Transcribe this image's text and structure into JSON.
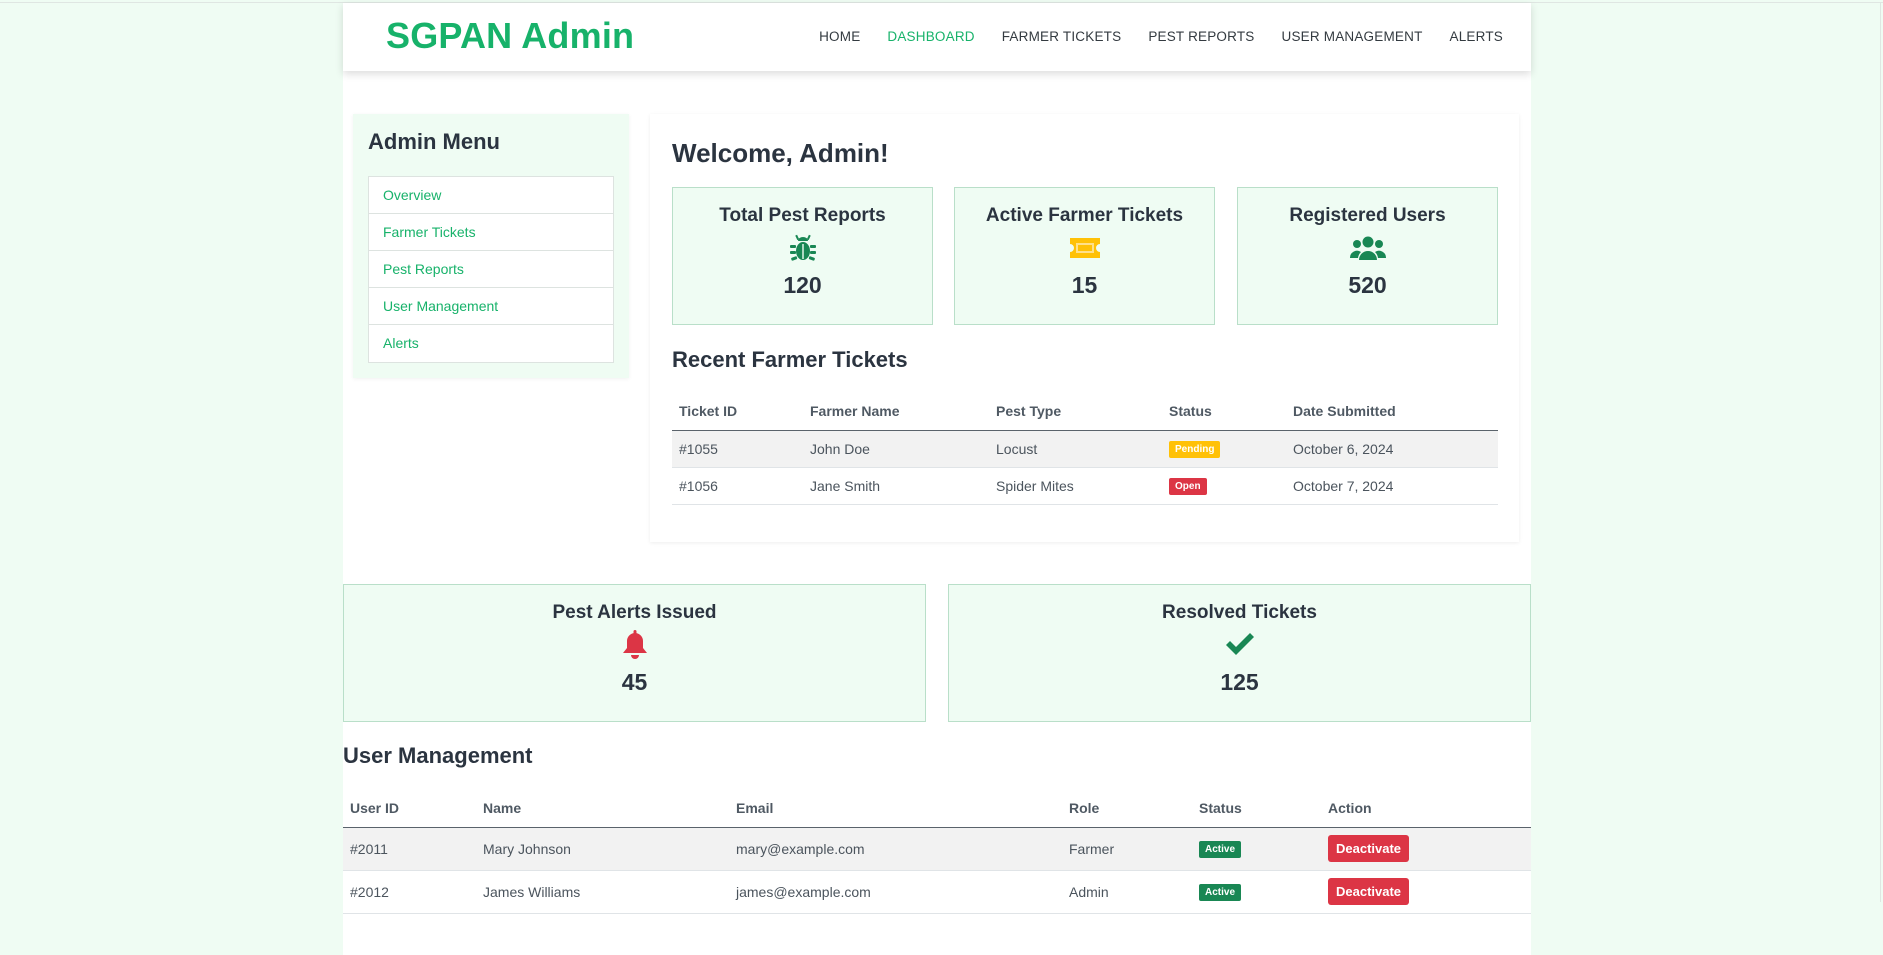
{
  "header": {
    "brand": "SGPAN Admin",
    "nav": [
      "HOME",
      "DASHBOARD",
      "FARMER TICKETS",
      "PEST REPORTS",
      "USER MANAGEMENT",
      "ALERTS"
    ],
    "active_nav": "DASHBOARD"
  },
  "sidebar": {
    "title": "Admin Menu",
    "items": [
      {
        "label": "Overview"
      },
      {
        "label": "Farmer Tickets"
      },
      {
        "label": "Pest Reports"
      },
      {
        "label": "User Management"
      },
      {
        "label": "Alerts"
      }
    ]
  },
  "main": {
    "welcome": "Welcome, Admin!",
    "stats": [
      {
        "title": "Total Pest Reports",
        "value": "120",
        "icon": "bug-icon",
        "color": "#198754"
      },
      {
        "title": "Active Farmer Tickets",
        "value": "15",
        "icon": "ticket-icon",
        "color": "#ffc107"
      },
      {
        "title": "Registered Users",
        "value": "520",
        "icon": "users-icon",
        "color": "#198754"
      }
    ],
    "recent_tickets": {
      "title": "Recent Farmer Tickets",
      "headers": [
        "Ticket ID",
        "Farmer Name",
        "Pest Type",
        "Status",
        "Date Submitted"
      ],
      "rows": [
        {
          "id": "#1055",
          "farmer": "John Doe",
          "pest": "Locust",
          "status": "Pending",
          "status_color": "#ffc107",
          "date": "October 6, 2024"
        },
        {
          "id": "#1056",
          "farmer": "Jane Smith",
          "pest": "Spider Mites",
          "status": "Open",
          "status_color": "#dc3545",
          "date": "October 7, 2024"
        }
      ]
    }
  },
  "lower_stats": [
    {
      "title": "Pest Alerts Issued",
      "value": "45",
      "icon": "bell-icon",
      "color": "#dc3545"
    },
    {
      "title": "Resolved Tickets",
      "value": "125",
      "icon": "check-icon",
      "color": "#198754"
    }
  ],
  "user_management": {
    "title": "User Management",
    "headers": [
      "User ID",
      "Name",
      "Email",
      "Role",
      "Status",
      "Action"
    ],
    "rows": [
      {
        "id": "#2011",
        "name": "Mary Johnson",
        "email": "mary@example.com",
        "role": "Farmer",
        "status": "Active",
        "action": "Deactivate"
      },
      {
        "id": "#2012",
        "name": "James Williams",
        "email": "james@example.com",
        "role": "Admin",
        "status": "Active",
        "action": "Deactivate"
      }
    ],
    "status_color": "#198754",
    "action_color": "#dc3545"
  },
  "colors": {
    "accent": "#17b26a",
    "card_bg": "#effcf3",
    "page_bg": "#effcf3"
  }
}
